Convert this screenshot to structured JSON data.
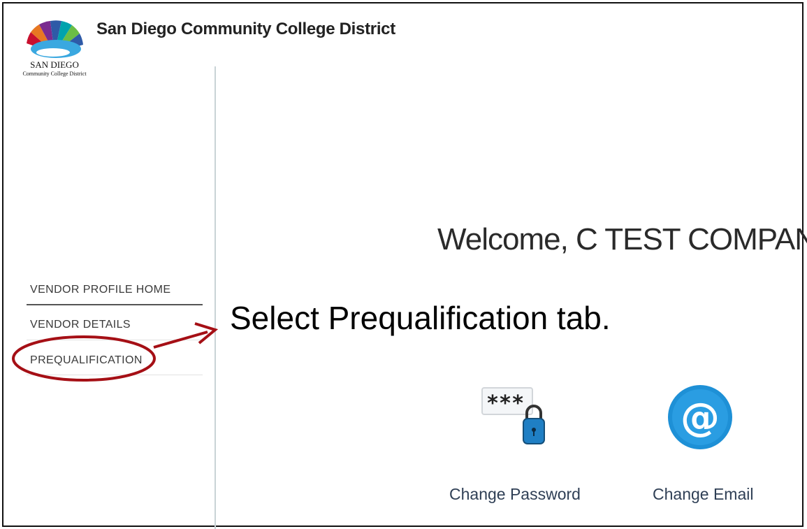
{
  "header": {
    "logo_name": "SAN DIEGO",
    "logo_sub": "Community College District",
    "title": "San Diego Community College District"
  },
  "sidebar": {
    "items": [
      {
        "label": "VENDOR PROFILE HOME",
        "active": true
      },
      {
        "label": "VENDOR DETAILS",
        "active": false
      },
      {
        "label": "PREQUALIFICATION",
        "active": false
      }
    ]
  },
  "main": {
    "welcome": "Welcome, C TEST COMPANY!",
    "callout": "Select Prequalification tab.",
    "actions": [
      {
        "label": "Change Password",
        "icon": "password-lock-icon",
        "mask_text": "***"
      },
      {
        "label": "Change Email",
        "icon": "email-at-icon",
        "symbol": "@"
      }
    ]
  },
  "colors": {
    "annotation_red": "#a50f15",
    "email_blue": "#1e90d6",
    "lock_blue": "#1f7fc4"
  }
}
